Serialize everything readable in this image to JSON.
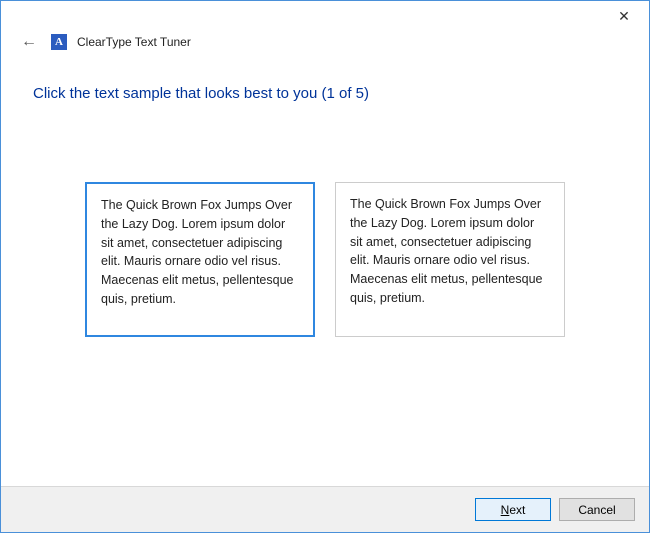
{
  "titlebar": {
    "close_glyph": "✕"
  },
  "header": {
    "back_glyph": "←",
    "app_icon_letter": "A",
    "app_title": "ClearType Text Tuner"
  },
  "main": {
    "heading": "Click the text sample that looks best to you (1 of 5)",
    "samples": [
      {
        "text": "The Quick Brown Fox Jumps Over the Lazy Dog. Lorem ipsum dolor sit amet, consectetuer adipiscing elit. Mauris ornare odio vel risus. Maecenas elit metus, pellentesque quis, pretium.",
        "selected": true
      },
      {
        "text": "The Quick Brown Fox Jumps Over the Lazy Dog. Lorem ipsum dolor sit amet, consectetuer adipiscing elit. Mauris ornare odio vel risus. Maecenas elit metus, pellentesque quis, pretium.",
        "selected": false
      }
    ]
  },
  "footer": {
    "next_label": "Next",
    "cancel_label": "Cancel"
  }
}
